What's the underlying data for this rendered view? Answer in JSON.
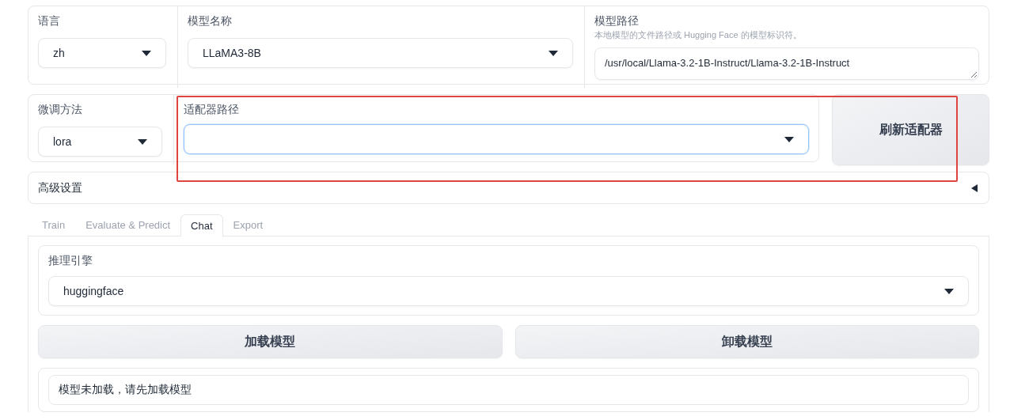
{
  "model_settings": {
    "language": {
      "label": "语言",
      "value": "zh"
    },
    "model_name": {
      "label": "模型名称",
      "value": "LLaMA3-8B"
    },
    "model_path": {
      "label": "模型路径",
      "info": "本地模型的文件路径或 Hugging Face 的模型标识符。",
      "value": "/usr/local/Llama-3.2-1B-Instruct/Llama-3.2-1B-Instruct"
    }
  },
  "adapter_settings": {
    "finetuning_method": {
      "label": "微调方法",
      "value": "lora"
    },
    "adapter_path": {
      "label": "适配器路径",
      "focused": true
    },
    "refresh_button": "刷新适配器"
  },
  "advanced_settings": {
    "label": "高级设置",
    "expanded": false
  },
  "tabs": [
    {
      "label": "Train",
      "selected": false
    },
    {
      "label": "Evaluate & Predict",
      "selected": false
    },
    {
      "label": "Chat",
      "selected": true
    },
    {
      "label": "Export",
      "selected": false
    }
  ],
  "chat": {
    "inference_engine": {
      "label": "推理引擎",
      "value": "huggingface"
    },
    "buttons": [
      "加载模型",
      "卸载模型"
    ],
    "status": "模型未加载，请先加载模型"
  }
}
